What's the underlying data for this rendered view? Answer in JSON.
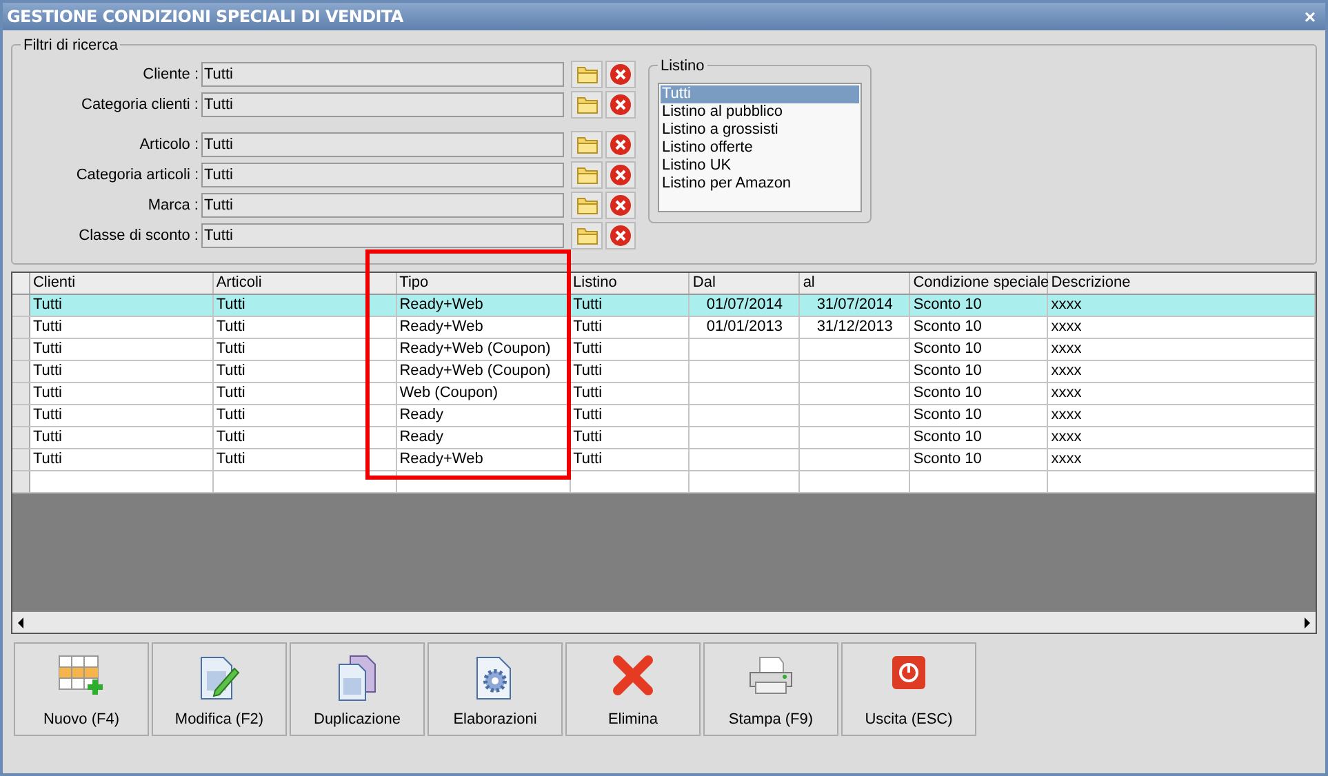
{
  "window": {
    "title": "GESTIONE CONDIZIONI SPECIALI DI VENDITA",
    "close": "×"
  },
  "filters": {
    "title": "Filtri di ricerca",
    "field_groups": [
      [
        {
          "label": "Cliente :",
          "value": "Tutti"
        },
        {
          "label": "Categoria clienti :",
          "value": "Tutti"
        }
      ],
      [
        {
          "label": "Articolo :",
          "value": "Tutti"
        },
        {
          "label": "Categoria articoli :",
          "value": "Tutti"
        },
        {
          "label": "Marca :",
          "value": "Tutti"
        },
        {
          "label": "Classe di sconto :",
          "value": "Tutti"
        }
      ]
    ]
  },
  "listino": {
    "title": "Listino",
    "items": [
      {
        "label": "Tutti",
        "selected": true
      },
      {
        "label": "Listino al pubblico",
        "selected": false
      },
      {
        "label": "Listino a grossisti",
        "selected": false
      },
      {
        "label": "Listino offerte",
        "selected": false
      },
      {
        "label": "Listino UK",
        "selected": false
      },
      {
        "label": "Listino per Amazon",
        "selected": false
      }
    ]
  },
  "table": {
    "columns": [
      "Clienti",
      "Articoli",
      "Tipo",
      "Listino",
      "Dal",
      "al",
      "Condizione speciale",
      "Descrizione"
    ],
    "rows": [
      {
        "selected": true,
        "cells": [
          "Tutti",
          "Tutti",
          "Ready+Web",
          "Tutti",
          "01/07/2014",
          "31/07/2014",
          "Sconto 10",
          "xxxx"
        ]
      },
      {
        "selected": false,
        "cells": [
          "Tutti",
          "Tutti",
          "Ready+Web",
          "Tutti",
          "01/01/2013",
          "31/12/2013",
          "Sconto 10",
          "xxxx"
        ]
      },
      {
        "selected": false,
        "cells": [
          "Tutti",
          "Tutti",
          "Ready+Web (Coupon)",
          "Tutti",
          "",
          "",
          "Sconto 10",
          "xxxx"
        ]
      },
      {
        "selected": false,
        "cells": [
          "Tutti",
          "Tutti",
          "Ready+Web (Coupon)",
          "Tutti",
          "",
          "",
          "Sconto 10",
          "xxxx"
        ]
      },
      {
        "selected": false,
        "cells": [
          "Tutti",
          "Tutti",
          "Web (Coupon)",
          "Tutti",
          "",
          "",
          "Sconto 10",
          "xxxx"
        ]
      },
      {
        "selected": false,
        "cells": [
          "Tutti",
          "Tutti",
          "Ready",
          "Tutti",
          "",
          "",
          "Sconto 10",
          "xxxx"
        ]
      },
      {
        "selected": false,
        "cells": [
          "Tutti",
          "Tutti",
          "Ready",
          "Tutti",
          "",
          "",
          "Sconto 10",
          "xxxx"
        ]
      },
      {
        "selected": false,
        "cells": [
          "Tutti",
          "Tutti",
          "Ready+Web",
          "Tutti",
          "",
          "",
          "Sconto 10",
          "xxxx"
        ]
      }
    ]
  },
  "toolbar": [
    {
      "kind": "new",
      "label": "Nuovo (F4)"
    },
    {
      "kind": "edit",
      "label": "Modifica (F2)"
    },
    {
      "kind": "duplicate",
      "label": "Duplicazione"
    },
    {
      "kind": "process",
      "label": "Elaborazioni"
    },
    {
      "kind": "delete",
      "label": "Elimina"
    },
    {
      "kind": "print",
      "label": "Stampa (F9)"
    },
    {
      "kind": "exit",
      "label": "Uscita (ESC)"
    }
  ]
}
